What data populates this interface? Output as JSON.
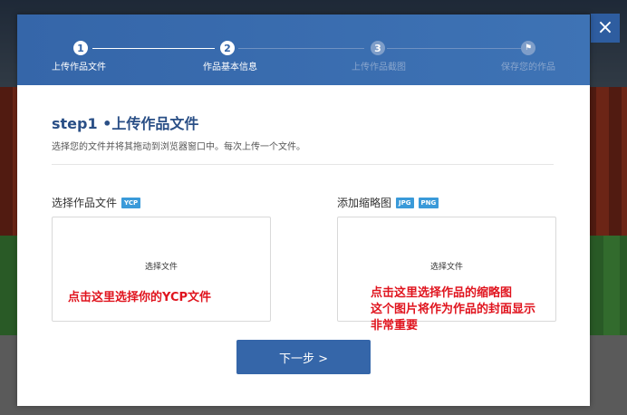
{
  "modal": {
    "close_icon": "×"
  },
  "steps": [
    {
      "number": "1",
      "label": "上传作品文件",
      "state": "active"
    },
    {
      "number": "2",
      "label": "作品基本信息",
      "state": "active"
    },
    {
      "number": "3",
      "label": "上传作品截图",
      "state": "inactive"
    },
    {
      "number": "⚑",
      "label": "保存您的作品",
      "state": "inactive"
    }
  ],
  "content": {
    "title": "step1 •上传作品文件",
    "description": "选择您的文件并将其拖动到浏览器窗口中。每次上传一个文件。",
    "left": {
      "label": "选择作品文件",
      "badges": [
        "YCP"
      ],
      "choose_text": "选择文件",
      "annotation": "点击这里选择你的YCP文件"
    },
    "right": {
      "label": "添加缩略图",
      "badges": [
        "JPG",
        "PNG"
      ],
      "choose_text": "选择文件",
      "annotation_lines": [
        "点击这里选择作品的缩略图",
        "这个图片将作为作品的封面显示",
        "非常重要"
      ]
    },
    "next_button": "下一步 >"
  },
  "colors": {
    "primary": "#3566a9",
    "annotation": "#e0141e",
    "badge": "#3a9ad9"
  }
}
